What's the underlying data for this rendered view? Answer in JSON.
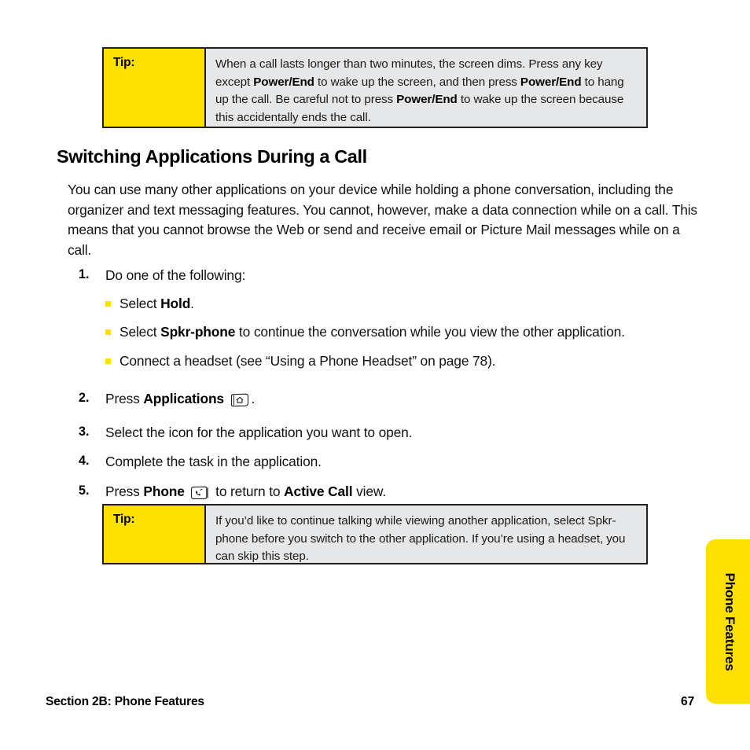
{
  "page": {
    "number": "67",
    "footer_section": "Section 2B: Phone Features",
    "side_tab_label": "Phone Features"
  },
  "colors": {
    "accent_yellow": "#ffe000",
    "tip_body_gray": "#e6e7e8",
    "border_dark": "#231f20",
    "text": "#111111"
  },
  "tip_top": {
    "label": "Tip:",
    "body_parts": [
      {
        "text": "When a call lasts longer than two minutes, the screen dims. Press any key except ",
        "bold": false
      },
      {
        "text": "Power/End",
        "bold": true
      },
      {
        "text": " to wake up the screen, and then press ",
        "bold": false
      },
      {
        "text": "Power/End",
        "bold": true
      },
      {
        "text": " to hang up the call. Be careful not to press ",
        "bold": false
      },
      {
        "text": "Power/End",
        "bold": true
      },
      {
        "text": " to wake up the screen because this accidentally ends the call.",
        "bold": false
      }
    ]
  },
  "tip_bottom": {
    "label": "Tip:",
    "body_parts": [
      {
        "text": "If you’d like to continue talking while viewing another application, select Spkr-phone before you switch to the other application. If you’re using a headset, you can skip this step.",
        "bold": false
      }
    ]
  },
  "heading": "Switching Applications During a Call",
  "intro": "You can use many other applications on your device while holding a phone conversation, including the organizer and text messaging features. You cannot, however, make a data connection while on a call. This means that you cannot browse the Web or send and receive email or Picture Mail messages while on a call.",
  "steps": [
    {
      "number": "1.",
      "parts": [
        {
          "text": "Do one of the following:",
          "bold": false
        }
      ],
      "sub_items": [
        {
          "parts": [
            {
              "text": "Select ",
              "bold": false
            },
            {
              "text": "Hold",
              "bold": true
            },
            {
              "text": ".",
              "bold": false
            }
          ]
        },
        {
          "parts": [
            {
              "text": "Select ",
              "bold": false
            },
            {
              "text": "Spkr-phone",
              "bold": true
            },
            {
              "text": " to continue the conversation while you view the other application.",
              "bold": false
            }
          ]
        },
        {
          "parts": [
            {
              "text": "Connect a headset (see “Using a Phone Headset” on page 78).",
              "bold": false
            }
          ]
        }
      ]
    },
    {
      "number": "2.",
      "parts": [
        {
          "text": "Press ",
          "bold": false
        },
        {
          "text": "Applications",
          "bold": true
        },
        {
          "text": " ",
          "bold": false
        },
        {
          "icon": "applications-key-icon"
        },
        {
          "text": ".",
          "bold": false
        }
      ],
      "sub_items": []
    },
    {
      "number": "3.",
      "parts": [
        {
          "text": "Select the icon for the application you want to open.",
          "bold": false
        }
      ],
      "sub_items": []
    },
    {
      "number": "4.",
      "parts": [
        {
          "text": "Complete the task in the application.",
          "bold": false
        }
      ],
      "sub_items": []
    },
    {
      "number": "5.",
      "parts": [
        {
          "text": "Press ",
          "bold": false
        },
        {
          "text": "Phone",
          "bold": true
        },
        {
          "text": " ",
          "bold": false
        },
        {
          "icon": "phone-key-icon"
        },
        {
          "text": " to return to ",
          "bold": false
        },
        {
          "text": "Active Call",
          "bold": true
        },
        {
          "text": " view.",
          "bold": false
        }
      ],
      "sub_items": []
    }
  ]
}
